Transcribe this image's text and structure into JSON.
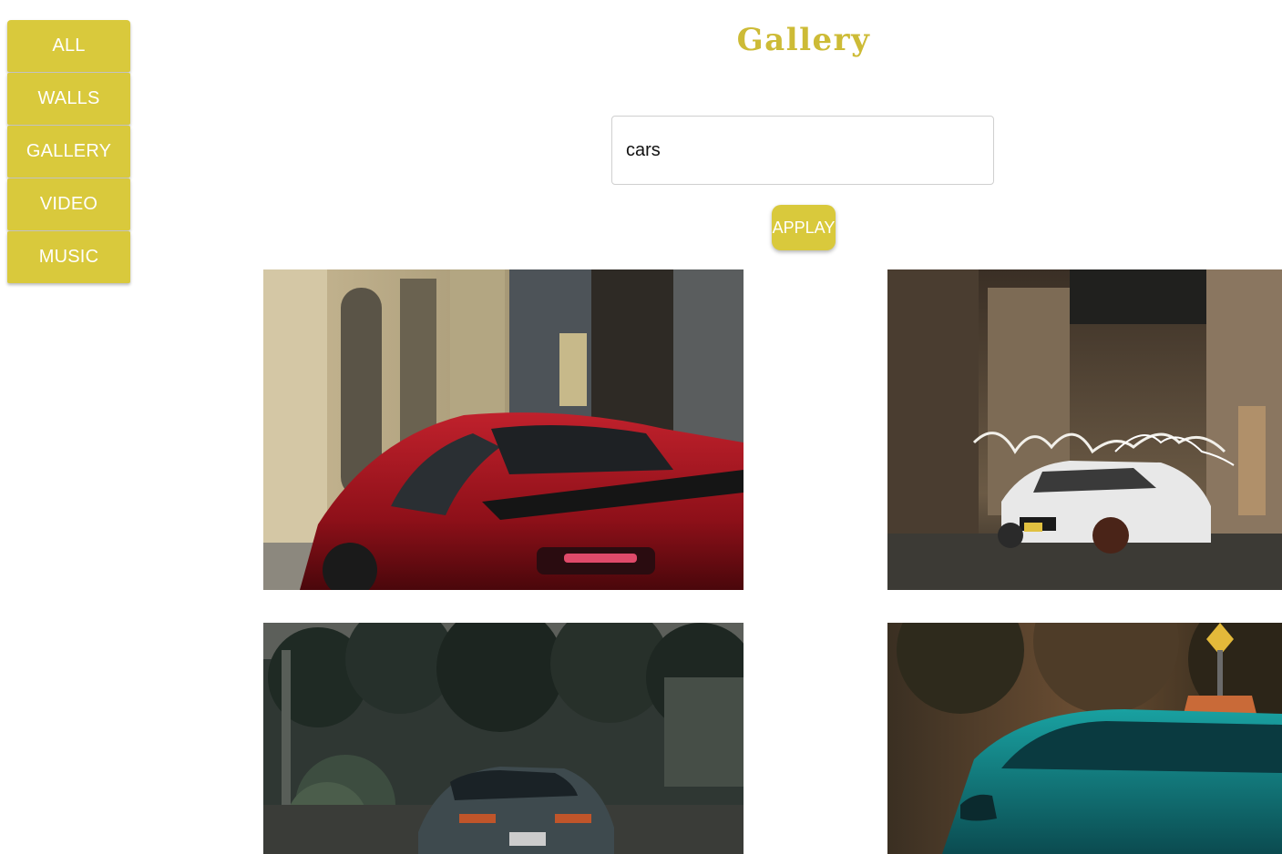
{
  "sidebar": {
    "items": [
      {
        "label": "ALL"
      },
      {
        "label": "WALLS"
      },
      {
        "label": "GALLERY"
      },
      {
        "label": "VIDEO"
      },
      {
        "label": "MUSIC"
      }
    ]
  },
  "header": {
    "title": "Gallery"
  },
  "search": {
    "value": "cars"
  },
  "actions": {
    "apply_label": "APPLAY"
  },
  "colors": {
    "accent": "#d9c93c",
    "title": "#cdbb36"
  },
  "gallery": {
    "images": [
      {
        "subject": "red sports car parked by stone building"
      },
      {
        "subject": "white muscle car with light painting at night"
      },
      {
        "subject": "dark sports car under trees"
      },
      {
        "subject": "teal car with road sign"
      }
    ]
  }
}
